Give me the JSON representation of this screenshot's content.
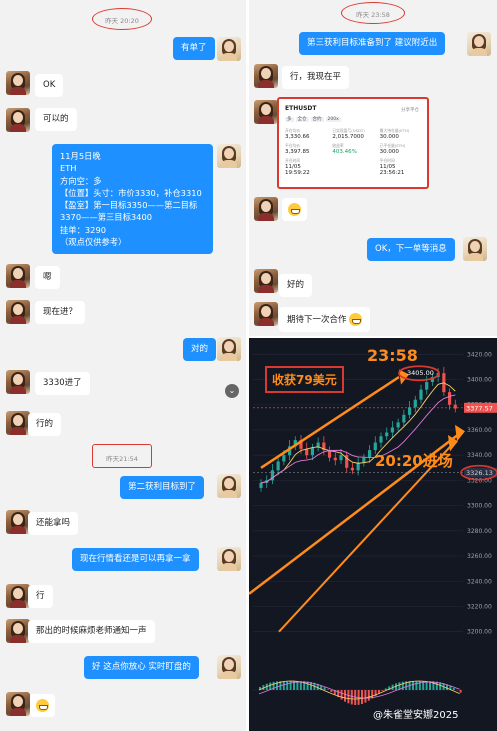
{
  "left_chat": {
    "timestamp1": "昨天 20:20",
    "timestamp2": "昨天21:54",
    "messages": [
      {
        "dir": "out",
        "text": "有单了"
      },
      {
        "dir": "in",
        "text": "OK"
      },
      {
        "dir": "in",
        "text": "可以的"
      },
      {
        "dir": "out",
        "lines": [
          "11月5日晚",
          "ETH",
          "方向空：多",
          "【位置】头寸：市价3330，补仓3310",
          "【盈室】第一目标3350——第二目标",
          "3370——第三目标3400",
          "挂单：3290",
          "（观点仅供参考）"
        ]
      },
      {
        "dir": "in",
        "text": "嗯"
      },
      {
        "dir": "in",
        "text": "现在进？"
      },
      {
        "dir": "out",
        "text": "对的"
      },
      {
        "dir": "in",
        "text": "3330进了"
      },
      {
        "dir": "in",
        "text": "行的"
      },
      {
        "dir": "out",
        "text": "第二获利目标到了"
      },
      {
        "dir": "in",
        "text": "还能拿吗"
      },
      {
        "dir": "out",
        "text": "现在行情看还是可以再拿一拿"
      },
      {
        "dir": "in",
        "text": "行"
      },
      {
        "dir": "in",
        "text": "那出的时候麻烦老师通知一声"
      },
      {
        "dir": "out",
        "text": "好 这点你放心 实时盯盘的"
      }
    ]
  },
  "right_chat": {
    "timestamp": "昨天 23:58",
    "messages": [
      {
        "dir": "out",
        "text": "第三获利目标准备到了 建议附近出"
      },
      {
        "dir": "in",
        "text": "行，我现在平"
      },
      {
        "dir": "out",
        "text": "OK，下一单等消息"
      },
      {
        "dir": "in",
        "text": "好的"
      },
      {
        "dir": "in",
        "text": "期待下一次合作"
      }
    ],
    "card": {
      "symbol": "ETHUSDT",
      "action": "分享平仓",
      "tags": [
        "多",
        "全仓",
        "合约",
        "200x"
      ],
      "rows": [
        {
          "label": "开仓均价",
          "value": "3,330.66"
        },
        {
          "label": "已实现盈亏(USDT)",
          "value": "2,015.7000"
        },
        {
          "label": "最大持仓量(ETH)",
          "value": "30.000"
        },
        {
          "label": "平仓均价",
          "value": "3,397.85"
        },
        {
          "label": "收益率",
          "value": "403.46%"
        },
        {
          "label": "已平仓量(ETH)",
          "value": "30.000"
        },
        {
          "label": "开仓时间",
          "value": "11/05 19:59:22"
        },
        {
          "label": "",
          "value": ""
        },
        {
          "label": "平仓时间",
          "value": "11/05 23:56:21"
        }
      ]
    }
  },
  "chart": {
    "profit_label": "收获79美元",
    "entry_label": "20:20进场",
    "exit_time_label": "23:58",
    "high_price": "3405.00",
    "current_price": "3377.57",
    "entry_price": "3326.13",
    "y_axis": [
      "3420.00",
      "3400.00",
      "3380.00",
      "3360.00",
      "3340.00",
      "3320.00",
      "3300.00",
      "3280.00",
      "3260.00",
      "3240.00",
      "3220.00",
      "3200.00"
    ],
    "watermark": "朱雀堂安娜2025",
    "watermark_prefix": "@",
    "colors": {
      "up": "#26a69a",
      "down": "#ef5350",
      "bg": "#131722",
      "annotation": "#ff8c1a"
    }
  },
  "chart_data": {
    "type": "line",
    "title": "",
    "xlabel": "",
    "ylabel": "",
    "ylim": [
      3195,
      3425
    ],
    "series": [
      {
        "name": "",
        "values": [
          3318,
          3320,
          3328,
          3335,
          3340,
          3347,
          3352,
          3345,
          3340,
          3346,
          3350,
          3344,
          3338,
          3336,
          3340,
          3330,
          3328,
          3334,
          3338,
          3344,
          3350,
          3355,
          3358,
          3362,
          3366,
          3372,
          3378,
          3384,
          3392,
          3398,
          3402,
          3405,
          3390,
          3380,
          3377
        ]
      }
    ]
  }
}
